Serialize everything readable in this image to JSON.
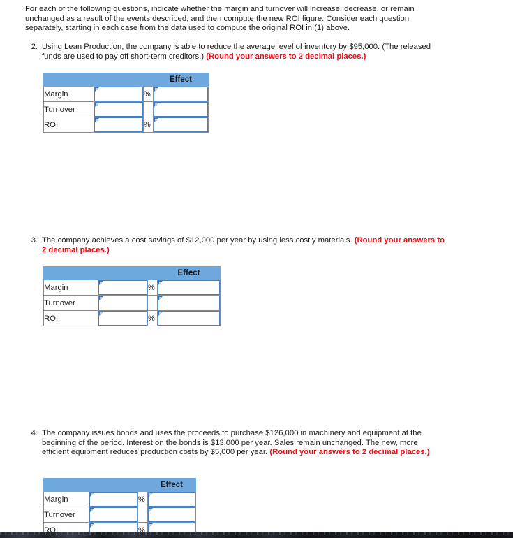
{
  "intro": {
    "text": "For each of the following questions, indicate whether the margin and turnover will increase, decrease, or remain unchanged as a result of the events described, and then compute the new ROI figure. Consider each question separately, starting in each case from the data used to compute the original ROI in (1) above."
  },
  "questions": [
    {
      "number": "2.",
      "text_plain": "Using Lean Production, the company is able to reduce the average level of inventory by $95,000. (The released funds are used to pay off short-term creditors.) ",
      "text_emphasis": "(Round your answers to 2 decimal places.)"
    },
    {
      "number": "3.",
      "text_plain": "The company achieves a cost savings of $12,000 per year by using less costly materials. ",
      "text_emphasis": "(Round your answers to 2 decimal places.)"
    },
    {
      "number": "4.",
      "text_plain": "The company issues bonds and uses the proceeds to purchase $126,000 in machinery and equipment at the beginning of the period. Interest on the bonds is $13,000 per year. Sales remain unchanged. The new, more efficient equipment reduces production costs by $5,000 per year. ",
      "text_emphasis": "(Round your answers to 2 decimal places.)"
    }
  ],
  "tables": [
    {
      "id": "table-question-2",
      "headers": [
        "",
        "",
        "",
        "Effect"
      ],
      "rows": [
        {
          "label": "Margin",
          "value": "",
          "unit": "%",
          "effect": ""
        },
        {
          "label": "Turnover",
          "value": "",
          "unit": "",
          "effect": ""
        },
        {
          "label": "ROI",
          "value": "",
          "unit": "%",
          "effect": ""
        }
      ]
    },
    {
      "id": "table-question-3",
      "headers": [
        "",
        "",
        "",
        "Effect"
      ],
      "rows": [
        {
          "label": "Margin",
          "value": "",
          "unit": "%",
          "effect": ""
        },
        {
          "label": "Turnover",
          "value": "",
          "unit": "",
          "effect": ""
        },
        {
          "label": "ROI",
          "value": "",
          "unit": "%",
          "effect": ""
        }
      ]
    },
    {
      "id": "table-question-4",
      "headers": [
        "",
        "",
        "",
        "Effect"
      ],
      "rows": [
        {
          "label": "Margin",
          "value": "",
          "unit": "%",
          "effect": ""
        },
        {
          "label": "Turnover",
          "value": "",
          "unit": "",
          "effect": ""
        },
        {
          "label": "ROI",
          "value": "",
          "unit": "%",
          "effect": ""
        }
      ]
    }
  ],
  "colors": {
    "header_blue": "#6fa8dd",
    "input_border_blue": "#4a7fbb",
    "emphasis_red": "#ef0a12",
    "table_grid": "#8a8a8a",
    "page_background": "#ffffff"
  }
}
